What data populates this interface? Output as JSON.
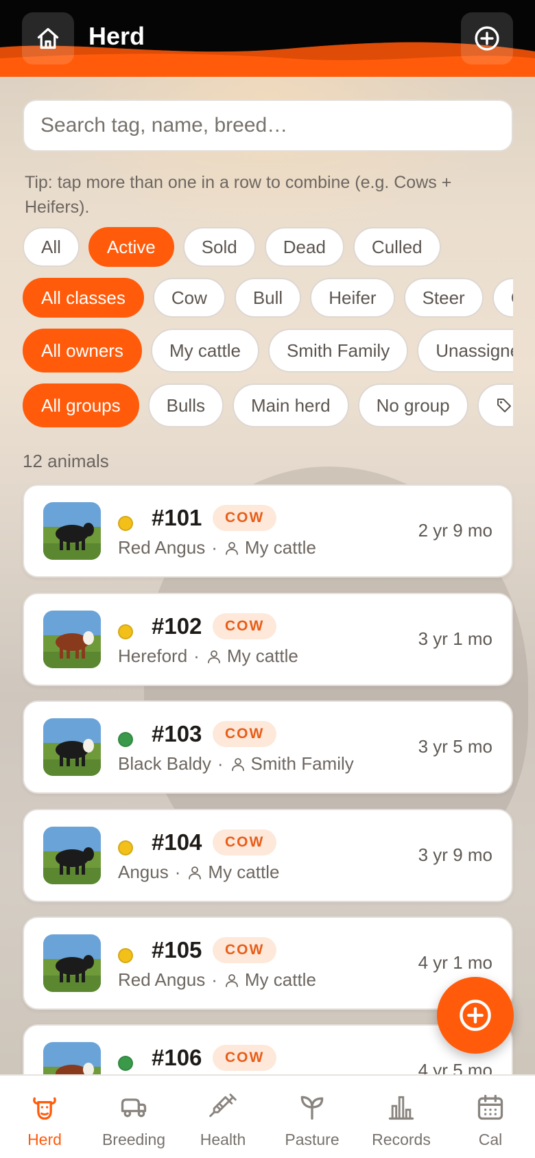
{
  "header": {
    "title": "Herd",
    "home_icon": "home-icon",
    "add_icon": "plus-circle-icon",
    "accent": "#ff5b0a"
  },
  "search": {
    "placeholder": "Search tag, name, breed…"
  },
  "tip": "Tip: tap more than one in a row to combine (e.g. Cows + Heifers).",
  "filters": {
    "status": [
      "All",
      "Active",
      "Sold",
      "Dead",
      "Culled"
    ],
    "classes": [
      "All classes",
      "Cow",
      "Bull",
      "Heifer",
      "Steer",
      "C"
    ],
    "owners": [
      "All owners",
      "My cattle",
      "Smith Family",
      "Unassigne"
    ],
    "groups": [
      "All groups",
      "Bulls",
      "Main herd",
      "No group",
      "_"
    ]
  },
  "count_text": "12 animals",
  "animals": [
    {
      "tag": "#101",
      "class": "COW",
      "breed": "Red Angus",
      "sep": "·",
      "owner": "My cattle",
      "age": "2 yr 9 mo",
      "status_color": "#f2c019",
      "photo": "black-cow"
    },
    {
      "tag": "#102",
      "class": "COW",
      "breed": "Hereford",
      "sep": "·",
      "owner": "My cattle",
      "age": "3 yr 1 mo",
      "status_color": "#f2c019",
      "photo": "hereford-cow"
    },
    {
      "tag": "#103",
      "class": "COW",
      "breed": "Black Baldy",
      "sep": "·",
      "owner": "Smith Family",
      "age": "3 yr 5 mo",
      "status_color": "#3a9a4a",
      "photo": "black-baldy-cow"
    },
    {
      "tag": "#104",
      "class": "COW",
      "breed": "Angus",
      "sep": "·",
      "owner": "My cattle",
      "age": "3 yr 9 mo",
      "status_color": "#f2c019",
      "photo": "black-cow"
    },
    {
      "tag": "#105",
      "class": "COW",
      "breed": "Red Angus",
      "sep": "·",
      "owner": "My cattle",
      "age": "4 yr 1 mo",
      "status_color": "#f2c019",
      "photo": "black-cow"
    },
    {
      "tag": "#106",
      "class": "COW",
      "breed": "",
      "sep": "",
      "owner": "",
      "age": "4 yr 5 mo",
      "status_color": "#3a9a4a",
      "photo": "hereford-cow"
    }
  ],
  "tabs": [
    {
      "label": "Herd",
      "icon": "cow-head-icon",
      "active": true
    },
    {
      "label": "Breeding",
      "icon": "trailer-icon",
      "active": false
    },
    {
      "label": "Health",
      "icon": "syringe-icon",
      "active": false
    },
    {
      "label": "Pasture",
      "icon": "sprout-icon",
      "active": false
    },
    {
      "label": "Records",
      "icon": "bar-chart-icon",
      "active": false
    },
    {
      "label": "Cal",
      "icon": "calendar-icon",
      "active": false
    }
  ]
}
